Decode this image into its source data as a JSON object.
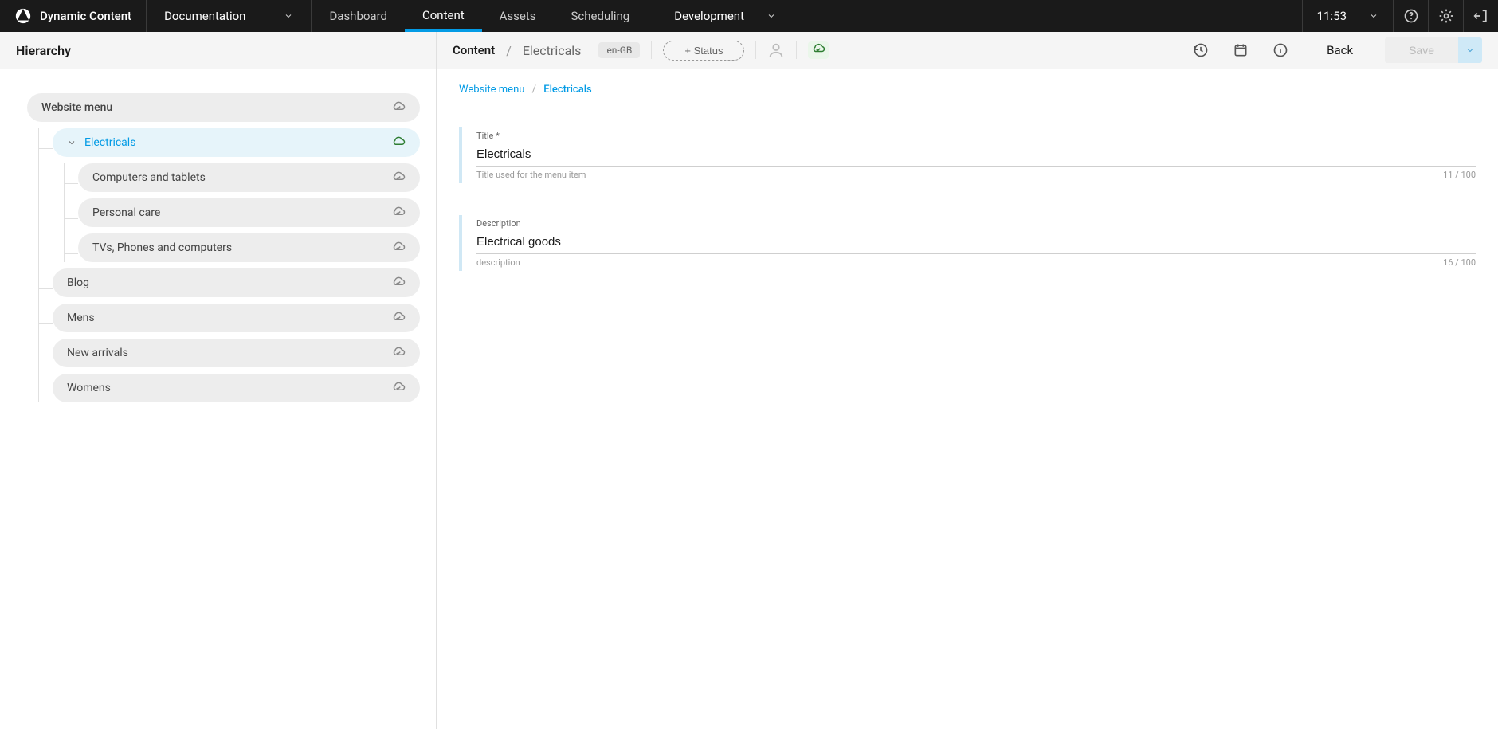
{
  "brand": {
    "name": "Dynamic Content"
  },
  "docDropdown": "Documentation",
  "nav": {
    "items": [
      "Dashboard",
      "Content",
      "Assets",
      "Scheduling"
    ],
    "active_index": 1
  },
  "environment": "Development",
  "clock": "11:53",
  "hierarchy": {
    "title": "Hierarchy",
    "root": {
      "label": "Website menu",
      "status": "cloud-done"
    },
    "children": [
      {
        "label": "Electricals",
        "status": "cloud-unsaved",
        "active": true,
        "children": [
          {
            "label": "Computers and tablets",
            "status": "cloud-done"
          },
          {
            "label": "Personal care",
            "status": "cloud-done"
          },
          {
            "label": "TVs, Phones and computers",
            "status": "cloud-done"
          }
        ]
      },
      {
        "label": "Blog",
        "status": "cloud-done"
      },
      {
        "label": "Mens",
        "status": "cloud-done"
      },
      {
        "label": "New arrivals",
        "status": "cloud-done"
      },
      {
        "label": "Womens",
        "status": "cloud-done"
      }
    ]
  },
  "subheader": {
    "crumb_root": "Content",
    "crumb_leaf": "Electricals",
    "locale": "en-GB",
    "status_btn": "+ Status",
    "back": "Back",
    "save": "Save"
  },
  "contentBreadcrumb": {
    "root": "Website menu",
    "current": "Electricals"
  },
  "fields": {
    "title": {
      "label": "Title",
      "required": "*",
      "value": "Electricals",
      "help": "Title used for the menu item",
      "counter": "11 / 100"
    },
    "description": {
      "label": "Description",
      "value": "Electrical goods",
      "help": "description",
      "counter": "16 / 100"
    }
  }
}
